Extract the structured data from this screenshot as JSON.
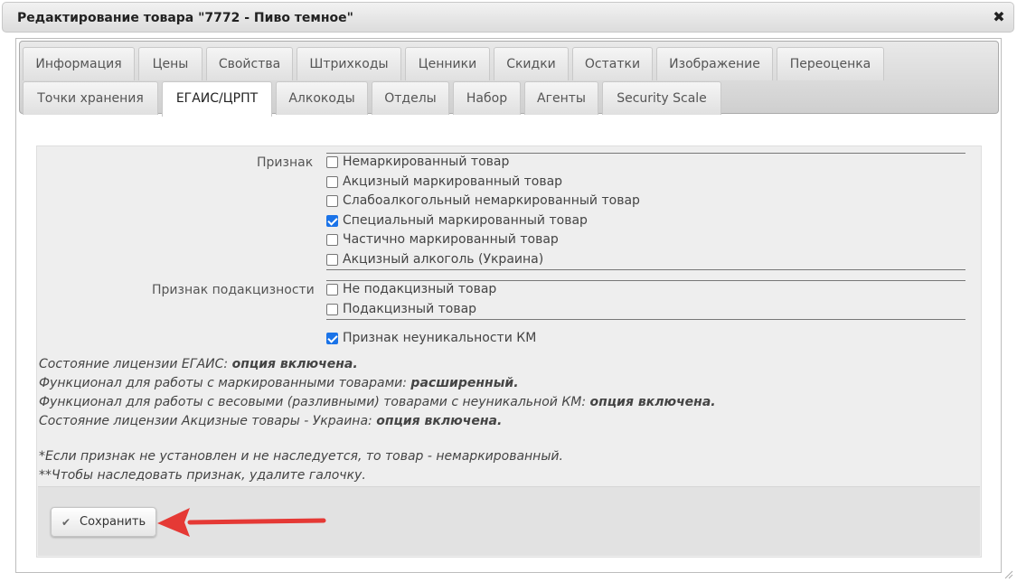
{
  "window": {
    "title": "Редактирование товара \"7772 - Пиво темное\"",
    "close_symbol": "✖"
  },
  "tabs": {
    "row1": [
      "Информация",
      "Цены",
      "Свойства",
      "Штрихкоды",
      "Ценники",
      "Скидки",
      "Остатки",
      "Изображение",
      "Переоценка"
    ],
    "row2": [
      "Точки хранения",
      "ЕГАИС/ЦРПТ",
      "Алкокоды",
      "Отделы",
      "Набор",
      "Агенты",
      "Security Scale"
    ],
    "active": "ЕГАИС/ЦРПТ"
  },
  "form": {
    "priznak_label": "Признак",
    "priznak_options": [
      {
        "label": "Немаркированный товар",
        "checked": false
      },
      {
        "label": "Акцизный маркированный товар",
        "checked": false
      },
      {
        "label": "Слабоалкогольный немаркированный товар",
        "checked": false
      },
      {
        "label": "Специальный маркированный товар",
        "checked": true
      },
      {
        "label": "Частично маркированный товар",
        "checked": false
      },
      {
        "label": "Акцизный алкоголь (Украина)",
        "checked": false
      }
    ],
    "excise_label": "Признак подакцизности",
    "excise_options": [
      {
        "label": "Не подакцизный товар",
        "checked": false
      },
      {
        "label": "Подакцизный товар",
        "checked": false
      }
    ],
    "nonunique": {
      "label": "Признак неуникальности КМ",
      "checked": true
    }
  },
  "info": [
    {
      "text": "Состояние лицензии ЕГАИС: ",
      "value": "опция включена."
    },
    {
      "text": "Функционал для работы с маркированными товарами: ",
      "value": "расширенный."
    },
    {
      "text": "Функционал для работы с весовыми (разливными) товарами с неуникальной КМ: ",
      "value": "опция включена."
    },
    {
      "text": "Состояние лицензии Акцизные товары - Украина: ",
      "value": "опция включена."
    }
  ],
  "notes": [
    "*Если признак не установлен и не наследуется, то товар - немаркированный.",
    "**Чтобы наследовать признак, удалите галочку."
  ],
  "save_label": "Сохранить",
  "colors": {
    "accent_checkbox": "#1a73e8",
    "arrow": "#e53935"
  }
}
